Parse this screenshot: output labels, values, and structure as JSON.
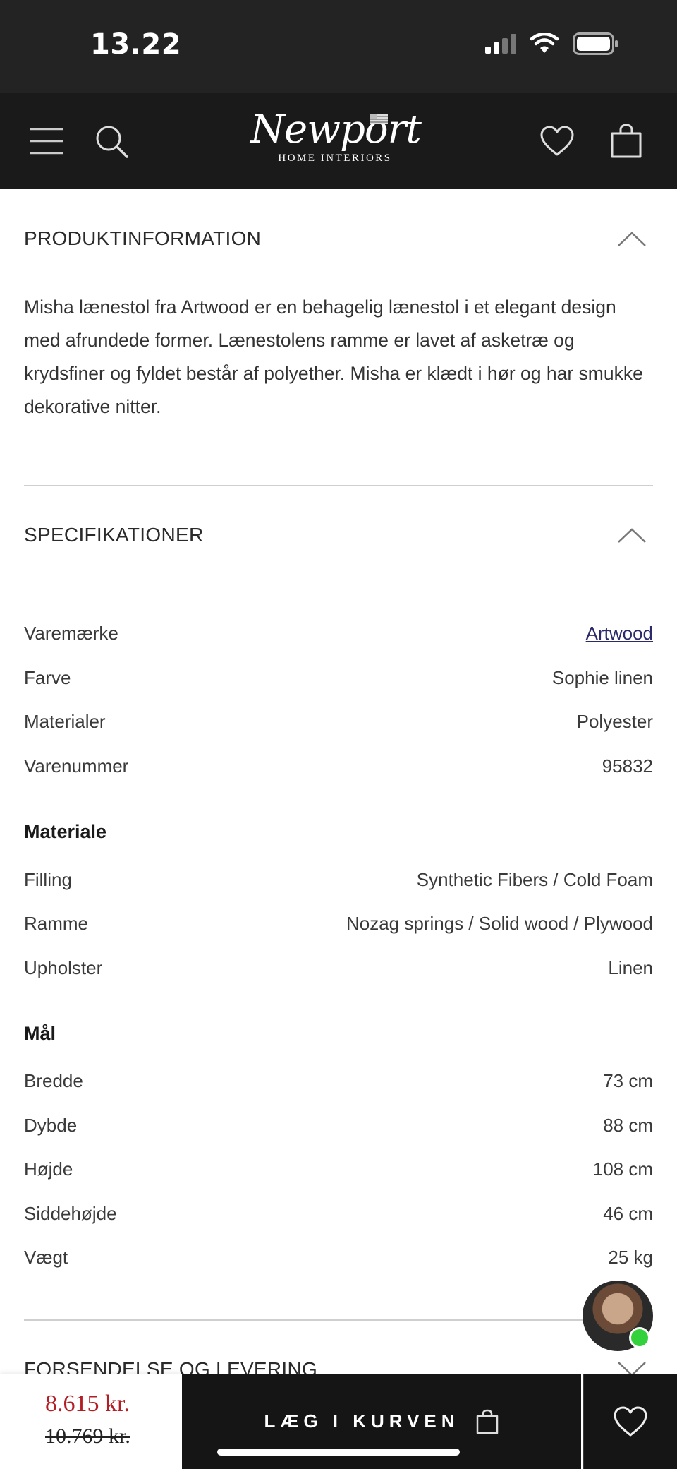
{
  "status_bar": {
    "time": "13.22",
    "icons": [
      "signal-icon",
      "wifi-icon",
      "battery-icon"
    ]
  },
  "header": {
    "logo_script": "Newport",
    "logo_sub": "HOME INTERIORS",
    "icons": [
      "menu-icon",
      "search-icon",
      "heart-icon",
      "shopping-bag-icon"
    ]
  },
  "product_info": {
    "title": "PRODUKTINFORMATION",
    "description": "Misha lænestol fra Artwood er en behagelig lænestol i et elegant design med afrundede former. Lænestolens ramme er lavet af asketræ og krydsfiner og fyldet består af polyether. Misha er klædt i hør og har smukke dekorative nitter."
  },
  "specifications": {
    "title": "SPECIFIKATIONER",
    "rows": [
      {
        "label": "Varemærke",
        "value": "Artwood"
      },
      {
        "label": "Farve",
        "value": "Sophie linen"
      },
      {
        "label": "Materialer",
        "value": "Polyester"
      },
      {
        "label": "Varenummer",
        "value": "95832"
      }
    ],
    "material": {
      "heading": "Materiale",
      "rows": [
        {
          "label": "Filling",
          "value": "Synthetic Fibers / Cold Foam"
        },
        {
          "label": "Ramme",
          "value": "Nozag springs / Solid wood / Plywood"
        },
        {
          "label": "Upholster",
          "value": "Linen"
        }
      ]
    },
    "dimensions": {
      "heading": "Mål",
      "rows": [
        {
          "label": "Bredde",
          "value": "73 cm"
        },
        {
          "label": "Dybde",
          "value": "88 cm"
        },
        {
          "label": "Højde",
          "value": "108 cm"
        },
        {
          "label": "Siddehøjde",
          "value": "46 cm"
        },
        {
          "label": "Vægt",
          "value": "25 kg"
        }
      ]
    }
  },
  "shipping": {
    "title": "FORSENDELSE OG LEVERING"
  },
  "purchase_bar": {
    "price_current": "8.615 kr.",
    "price_old": "10.769 kr.",
    "cart_label": "LÆG I KURVEN"
  },
  "colors": {
    "price_red": "#b21e23",
    "header_bg": "#1a1a1a",
    "status_bg": "#232323",
    "online_green": "#33d13b"
  }
}
